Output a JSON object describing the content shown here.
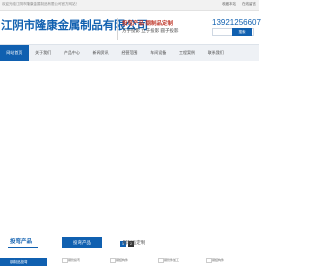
{
  "topbar": {
    "welcome": "欢迎光临江阴市隆康金属制品有限公司官方网站！",
    "link1": "收藏本站",
    "link2": "在线留言"
  },
  "header": {
    "company": "江阴市隆康金属制品有限公司",
    "slogan_main": "投弯产品 钢制品定制",
    "slogan_sub": "方子投影 立于投影 圆子投影",
    "phone": "13921256607",
    "search_label": "搜索"
  },
  "nav": {
    "items": [
      "网站首页",
      "关于我们",
      "产品中心",
      "新闻资讯",
      "经营范围",
      "车间设备",
      "工程案例",
      "联系我们"
    ],
    "active_index": 0
  },
  "slider": {
    "dots": [
      "1",
      "2"
    ],
    "active_index": 0
  },
  "products_panel": {
    "title": "投弯产品",
    "first_category": "钢制品投弯"
  },
  "tabs": {
    "items": [
      "投弯产品",
      "钢制品定制"
    ],
    "active_index": 0
  },
  "thumbnails": [
    "钢管投弯",
    "钢结构件",
    "钢管件加工",
    "钢结构件"
  ],
  "colors": {
    "brand": "#1060b0",
    "accent": "#c0392b"
  }
}
